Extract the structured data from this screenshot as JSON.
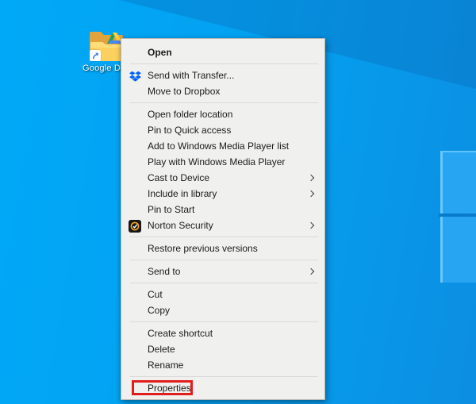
{
  "desktop": {
    "icon_label": "Google D"
  },
  "menu": {
    "groups": [
      {
        "items": [
          {
            "label": "Open"
          }
        ]
      },
      {
        "items": [
          {
            "label": "Send with Transfer...",
            "icon": "dropbox-icon"
          },
          {
            "label": "Move to Dropbox"
          }
        ]
      },
      {
        "items": [
          {
            "label": "Open folder location"
          },
          {
            "label": "Pin to Quick access"
          },
          {
            "label": "Add to Windows Media Player list"
          },
          {
            "label": "Play with Windows Media Player"
          },
          {
            "label": "Cast to Device",
            "submenu": true
          },
          {
            "label": "Include in library",
            "submenu": true
          },
          {
            "label": "Pin to Start"
          },
          {
            "label": "Norton Security",
            "icon": "norton-security-icon",
            "submenu": true
          }
        ]
      },
      {
        "items": [
          {
            "label": "Restore previous versions"
          }
        ]
      },
      {
        "items": [
          {
            "label": "Send to",
            "submenu": true
          }
        ]
      },
      {
        "items": [
          {
            "label": "Cut"
          },
          {
            "label": "Copy"
          }
        ]
      },
      {
        "items": [
          {
            "label": "Create shortcut"
          },
          {
            "label": "Delete"
          },
          {
            "label": "Rename"
          }
        ]
      },
      {
        "items": [
          {
            "label": "Properties",
            "annotated": true
          }
        ]
      }
    ]
  },
  "icons": {
    "dropbox": "dropbox-icon",
    "norton": "norton-security-icon",
    "submenu": "chevron-right-icon",
    "shortcut": "shortcut-arrow-icon",
    "desktop_folder": "google-drive-folder-icon"
  },
  "colors": {
    "annotation_red": "#e21d1d",
    "desktop_blue": "#04a0f0",
    "menu_background": "#f0f0ee",
    "dropbox_blue": "#0062ff",
    "norton_yellow": "#f2a71d",
    "folder_yellow": "#fbd05e"
  }
}
